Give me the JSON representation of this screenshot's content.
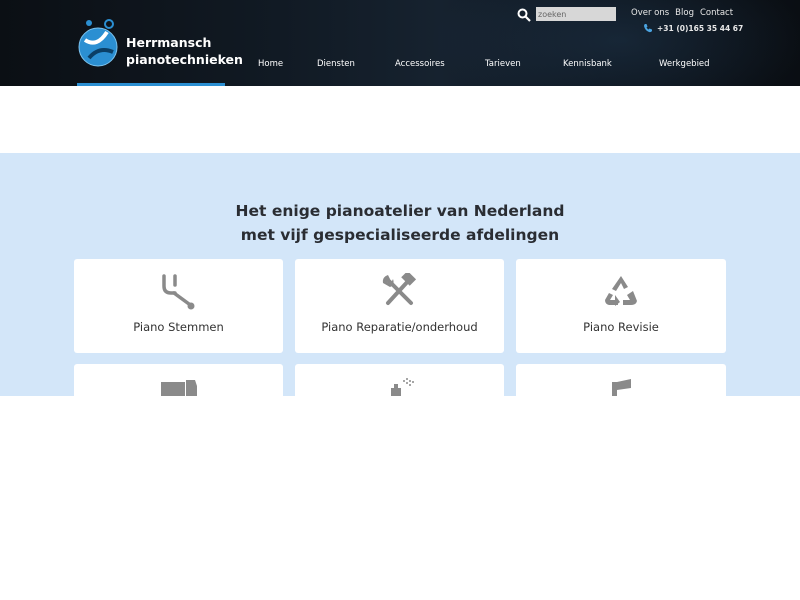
{
  "header": {
    "brand_line1": "Herrmansch",
    "brand_line2": "pianotechnieken",
    "search": {
      "placeholder": "zoeken"
    },
    "toplinks": [
      "Over ons",
      "Blog",
      "Contact"
    ],
    "phone": "+31 (0)165 35 44 67",
    "nav": [
      "Home",
      "Diensten",
      "Accessoires",
      "Tarieven",
      "Kennisbank",
      "Werkgebied"
    ]
  },
  "main": {
    "headline_line1": "Het enige pianoatelier van Nederland",
    "headline_line2": "met vijf gespecialiseerde afdelingen",
    "cards": [
      {
        "label": "Piano Stemmen",
        "icon": "tuning-fork-icon"
      },
      {
        "label": "Piano Reparatie/onderhoud",
        "icon": "hammer-wrench-icon"
      },
      {
        "label": "Piano Revisie",
        "icon": "recycle-icon"
      },
      {
        "label": "",
        "icon": "truck-icon"
      },
      {
        "label": "",
        "icon": "spray-icon"
      },
      {
        "label": "",
        "icon": "flag-icon"
      }
    ]
  },
  "colors": {
    "header_bg": "#0f1720",
    "accent": "#2b8fd2",
    "section_bg": "#d3e6f9",
    "icon_gray": "#8a8a8a"
  }
}
